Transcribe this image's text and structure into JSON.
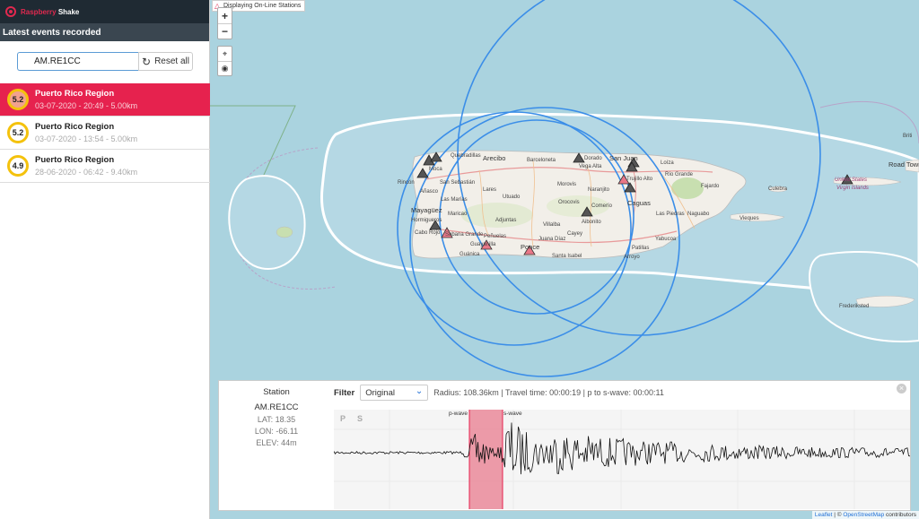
{
  "brand": {
    "name_part1": "Raspberry",
    "name_part2": "Shake"
  },
  "sidebar": {
    "header": "Latest events recorded",
    "search_value": "AM.RE1CC",
    "reset_label": "Reset all",
    "events": [
      {
        "magnitude": "5.2",
        "title": "Puerto Rico Region",
        "subtitle": "03-07-2020 - 20:49 - 5.00km",
        "active": true
      },
      {
        "magnitude": "5.2",
        "title": "Puerto Rico Region",
        "subtitle": "03-07-2020 - 13:54 - 5.00km",
        "active": false
      },
      {
        "magnitude": "4.9",
        "title": "Puerto Rico Region",
        "subtitle": "28-06-2020 - 06:42 - 9.40km",
        "active": false
      }
    ]
  },
  "map": {
    "online_label": "Displaying On-Line Stations",
    "zoom_in": "+",
    "zoom_out": "−",
    "labels": {
      "arecibo": "Arecibo",
      "barceloneta": "Barceloneta",
      "dorado": "Dorado",
      "san_juan": "San Juan",
      "vega_alta": "Vega Alta",
      "loiza": "Loíza",
      "trujillo_alto": "Trujillo Alto",
      "rio_grande": "Río Grande",
      "fajardo": "Fajardo",
      "culebra": "Culebra",
      "quebradillas": "Quebradillas",
      "moca": "Moca",
      "rincon": "Rincón",
      "anasco": "Añasco",
      "san_sebastian": "San Sebastián",
      "las_marias": "Las Marías",
      "lares": "Lares",
      "utuado": "Utuado",
      "morovis": "Morovis",
      "naranjito": "Naranjito",
      "caguas": "Caguas",
      "mayaguez": "Mayagüez",
      "maricao": "Maricao",
      "orocovis": "Orocovis",
      "comerio": "Comerío",
      "las_piedras": "Las Piedras",
      "naguabo": "Naguabo",
      "hormigueros": "Hormigueros",
      "adjuntas": "Adjuntas",
      "villalba": "Villalba",
      "aibonito": "Aibonito",
      "cabo_rojo": "Cabo Rojo",
      "sabana_grande": "Sabana Grande",
      "penuelas": "Peñuelas",
      "cayey": "Cayey",
      "yabucoa": "Yabucoa",
      "guayanilla": "Guayanilla",
      "ponce": "Ponce",
      "juana_diaz": "Juana Díaz",
      "guanica": "Guánica",
      "santa_isabel": "Santa Isabel",
      "patillas": "Patillas",
      "arroyo": "Arroyo",
      "vieques": "Vieques",
      "us_virgin_islands_1": "United States",
      "us_virgin_islands_2": "Virgin Islands",
      "road_town": "Road Town",
      "frederiksted": "Frederiksted",
      "bri": "Briti"
    }
  },
  "panel": {
    "station_heading": "Station",
    "station_code": "AM.RE1CC",
    "lat": "LAT: 18.35",
    "lon": "LON: -66.11",
    "elev": "ELEV: 44m",
    "filter_label": "Filter",
    "filter_value": "Original",
    "info": "Radius: 108.36km | Travel time: 00:00:19 | p to s-wave: 00:00:11",
    "p_label": "P",
    "s_label": "S",
    "pwave_label": "p-wave",
    "swave_label": "s-wave",
    "close": "×"
  },
  "attribution": {
    "leaflet": "Leaflet",
    "sep": " | © ",
    "osm": "OpenStreetMap",
    "contrib": " contributors"
  },
  "colors": {
    "accent": "#e6224e",
    "circle": "#3b8ee8",
    "magnitude_ring": "#f4c20d"
  }
}
